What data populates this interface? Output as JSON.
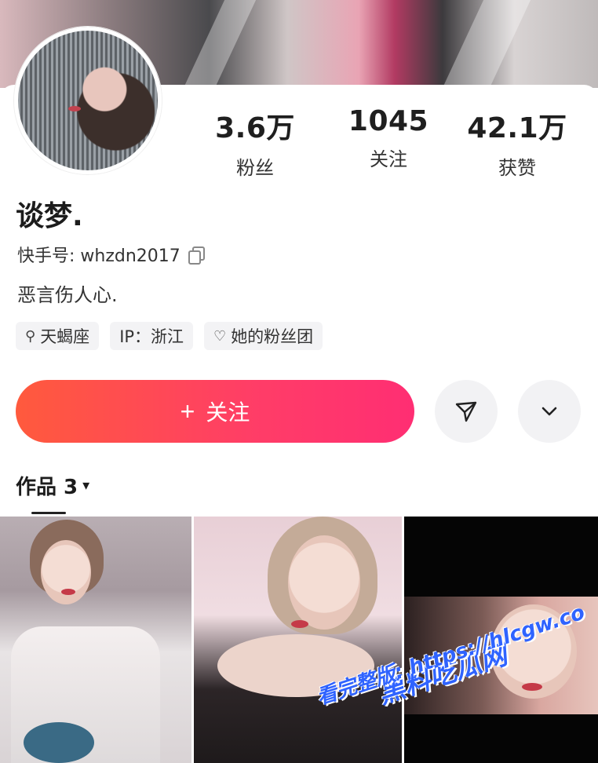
{
  "stats": [
    {
      "value": "3.6万",
      "label": "粉丝"
    },
    {
      "value": "1045",
      "label": "关注"
    },
    {
      "value": "42.1万",
      "label": "获赞"
    }
  ],
  "profile": {
    "name": "谈梦.",
    "kuaishou_id": "快手号: whzdn2017",
    "bio": "恶言伤人心."
  },
  "tags": [
    {
      "icon": "search-icon",
      "glyph": "⚲",
      "label": "天蝎座"
    },
    {
      "icon": "",
      "glyph": "",
      "label": "IP：浙江"
    },
    {
      "icon": "heart-icon",
      "glyph": "♡",
      "label": "她的粉丝团"
    }
  ],
  "actions": {
    "follow_plus": "+",
    "follow_label": "关注"
  },
  "works": {
    "tab_label": "作品 3",
    "caret": "▾"
  },
  "watermark": {
    "title": "黑料吃瓜网",
    "url_line": "看完整版: https://hlcgw.co"
  },
  "colors": {
    "follow_gradient_start": "#ff5a3d",
    "follow_gradient_end": "#ff2e73",
    "watermark": "#2f63ff"
  }
}
